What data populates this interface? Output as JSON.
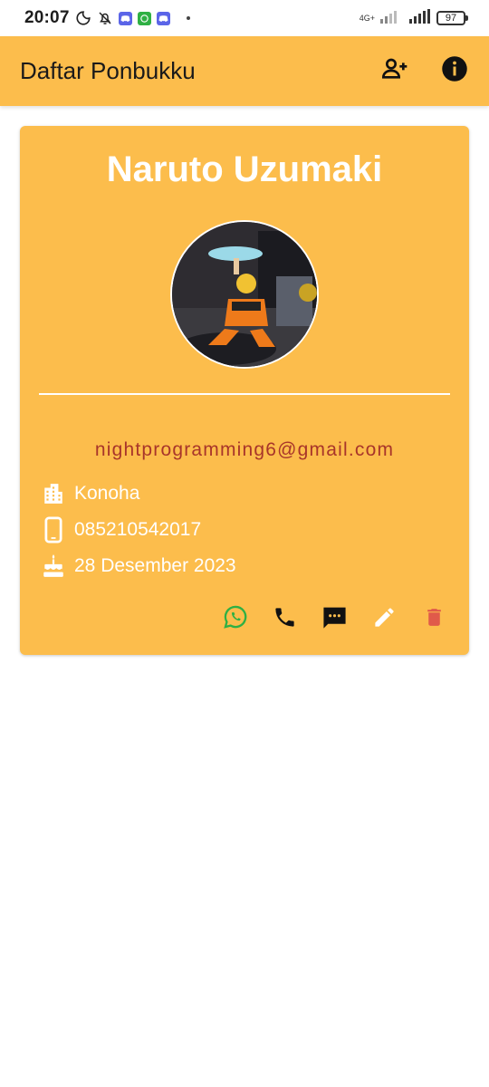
{
  "status_bar": {
    "time": "20:07",
    "network": "4G+",
    "battery": "97"
  },
  "app_bar": {
    "title": "Daftar Ponbukku"
  },
  "contact": {
    "name": "Naruto Uzumaki",
    "email": "nightprogramming6@gmail.com",
    "city": "Konoha",
    "phone": "085210542017",
    "birthday": "28 Desember 2023"
  },
  "colors": {
    "primary": "#fcbd4c",
    "email_text": "#a8352a",
    "whatsapp": "#2fb044",
    "delete": "#e05a4a"
  },
  "icons": {
    "add_contact": "person-add-icon",
    "info": "info-icon",
    "city": "apartment-icon",
    "phone": "smartphone-icon",
    "birthday": "cake-icon",
    "whatsapp": "whatsapp-icon",
    "call": "phone-icon",
    "sms": "sms-icon",
    "edit": "edit-icon",
    "delete": "delete-icon"
  }
}
